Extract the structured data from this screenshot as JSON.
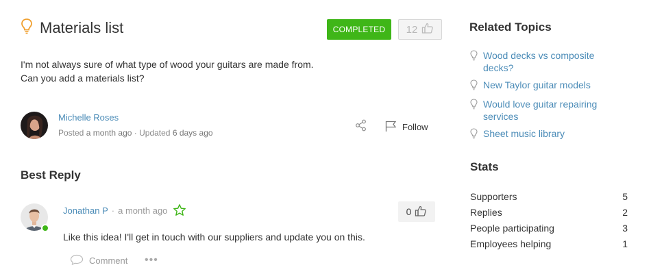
{
  "post": {
    "title": "Materials list",
    "status_badge": "COMPLETED",
    "vote_count": "12",
    "description_line1": "I'm not always sure of what type of wood your guitars are made from.",
    "description_line2": "Can you add a materials list?",
    "author": {
      "name": "Michelle Roses",
      "posted_prefix": "Posted",
      "posted_time": "a month ago",
      "separator": "·",
      "updated_prefix": "Updated",
      "updated_time": "6 days ago"
    },
    "follow_label": "Follow"
  },
  "best_reply": {
    "heading": "Best Reply",
    "author_name": "Jonathan P",
    "separator": "·",
    "time": "a month ago",
    "vote_count": "0",
    "text": "Like this idea! I'll get in touch with our suppliers and update you on this.",
    "comment_label": "Comment",
    "more_label": "•••"
  },
  "sidebar": {
    "related_title": "Related Topics",
    "related_topics": [
      "Wood decks vs composite decks?",
      "New Taylor guitar models",
      "Would love guitar repairing services",
      "Sheet music library"
    ],
    "stats_title": "Stats",
    "stats": [
      {
        "label": "Supporters",
        "value": "5"
      },
      {
        "label": "Replies",
        "value": "2"
      },
      {
        "label": "People participating",
        "value": "3"
      },
      {
        "label": "Employees helping",
        "value": "1"
      }
    ]
  },
  "colors": {
    "accent_green": "#3fb618",
    "link_blue": "#4a8bb7",
    "idea_bulb": "#f0a030"
  },
  "icons": {
    "title": "lightbulb-icon",
    "vote": "thumbs-up-icon",
    "share": "share-icon",
    "follow": "flag-icon",
    "favorite": "star-icon",
    "comment": "speech-bubble-icon",
    "related": "lightbulb-outline-icon"
  }
}
